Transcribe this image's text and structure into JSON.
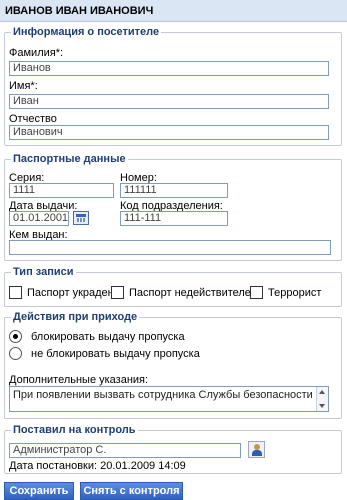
{
  "header": {
    "title": "ИВАНОВ ИВАН ИВАНОВИЧ"
  },
  "visitor": {
    "legend": "Информация о посетителе",
    "last_name_label": "Фамилия*:",
    "last_name_value": "Иванов",
    "first_name_label": "Имя*:",
    "first_name_value": "Иван",
    "patronymic_label": "Отчество",
    "patronymic_value": "Иванович"
  },
  "passport": {
    "legend": "Паспортные данные",
    "series_label": "Серия:",
    "series_value": "1111",
    "number_label": "Номер:",
    "number_value": "111111",
    "issue_date_label": "Дата выдачи:",
    "issue_date_value": "01.01.2001",
    "division_code_label": "Код подразделения:",
    "division_code_value": "111-111",
    "issued_by_label": "Кем выдан:",
    "issued_by_value": ""
  },
  "record_type": {
    "legend": "Тип записи",
    "options": [
      "Паспорт украден",
      "Паспорт недействителен",
      "Террорист"
    ]
  },
  "actions": {
    "legend": "Действия при приходе",
    "radio_block": "блокировать выдачу пропуска",
    "radio_no_block": "не блокировать выдачу пропуска",
    "selected": "block",
    "extra_label": "Дополнительные указания:",
    "extra_value": "При появлении вызвать сотрудника Службы безопасности"
  },
  "control": {
    "legend": "Поставил на контроль",
    "by_value": "Администратор С.",
    "date_text": "Дата постановки: 20.01.2009 14:09"
  },
  "buttons": {
    "save": "Сохранить",
    "remove_control": "Снять с контроля"
  },
  "colors": {
    "header_bg": "#dbe6f4",
    "legend_text": "#1f3f72",
    "button_bg": "#2f62c2"
  }
}
